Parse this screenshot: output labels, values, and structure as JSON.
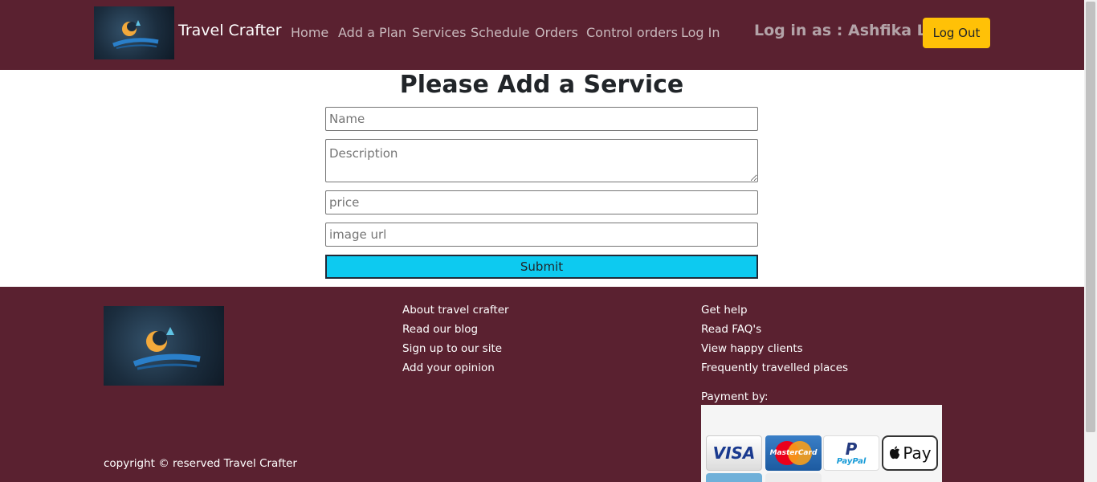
{
  "navbar": {
    "brand": "Travel Crafter",
    "logo_icon": "dream-logo-icon",
    "links": [
      "Home",
      "Add a Plan",
      "Services",
      "Schedule",
      "Orders",
      "Control orders",
      "Log In"
    ],
    "user_label": "Log in as : Ashfika Lira",
    "logout_label": "Log Out"
  },
  "form": {
    "title": "Please Add a Service",
    "name_placeholder": "Name",
    "description_placeholder": "Description",
    "price_placeholder": "price",
    "image_placeholder": "image url",
    "submit_label": "Submit"
  },
  "footer": {
    "col1": [
      "About travel crafter",
      "Read our blog",
      "Sign up to our site",
      "Add your opinion"
    ],
    "col2": [
      "Get help",
      "Read FAQ's",
      "View happy clients",
      "Frequently travelled places"
    ],
    "payment_label": "Payment by:",
    "cards": {
      "visa": "VISA",
      "mastercard": "MasterCard",
      "paypal": "PayPal",
      "applepay": "Pay"
    },
    "copyright": "copyright © reserved Travel Crafter"
  },
  "colors": {
    "navbar_bg": "#5a2130",
    "footer_bg": "#5a2130",
    "logout_button": "#ffc107",
    "submit_button": "#0dcaf0"
  }
}
